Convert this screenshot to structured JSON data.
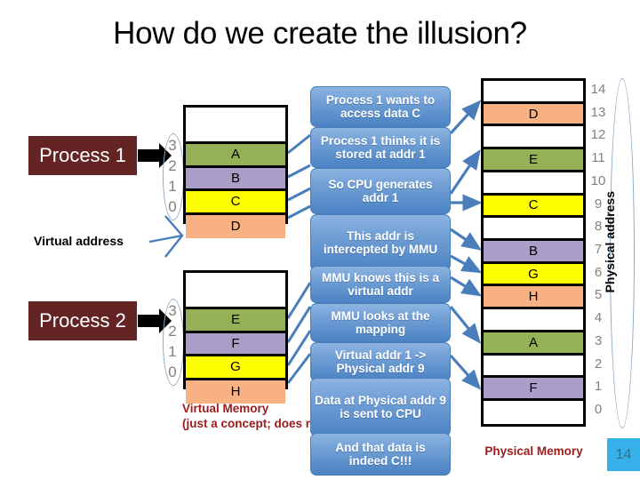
{
  "slide": {
    "title": "How do we create the illusion?",
    "page_number": "14"
  },
  "processes": [
    {
      "name": "process-1",
      "label": "Process 1"
    },
    {
      "name": "process-2",
      "label": "Process 2"
    }
  ],
  "labels": {
    "virtual_address": "Virtual address",
    "physical_address": "Physical address",
    "virtual_memory_line1": "Virtual Memory",
    "virtual_memory_line2": "(just a concept; does not exist physically)",
    "physical_memory": "Physical Memory"
  },
  "virtual_tables": [
    {
      "owner": "Process 1",
      "addresses": [
        "3",
        "2",
        "1",
        "0"
      ],
      "rows": [
        {
          "label": "",
          "color": "#ffffff"
        },
        {
          "label": "A",
          "color": "#94b155"
        },
        {
          "label": "B",
          "color": "#aa9dc8"
        },
        {
          "label": "C",
          "color": "#ffff00"
        },
        {
          "label": "D",
          "color": "#f8b183"
        }
      ]
    },
    {
      "owner": "Process 2",
      "addresses": [
        "3",
        "2",
        "1",
        "0"
      ],
      "rows": [
        {
          "label": "",
          "color": "#ffffff"
        },
        {
          "label": "E",
          "color": "#94b155"
        },
        {
          "label": "F",
          "color": "#aa9dc8"
        },
        {
          "label": "G",
          "color": "#ffff00"
        },
        {
          "label": "H",
          "color": "#f8b183"
        }
      ]
    }
  ],
  "physical_table": {
    "addresses": [
      "14",
      "13",
      "12",
      "11",
      "10",
      "9",
      "8",
      "7",
      "6",
      "5",
      "4",
      "3",
      "2",
      "1",
      "0"
    ],
    "rows": [
      {
        "addr": "14",
        "label": "",
        "color": "#ffffff"
      },
      {
        "addr": "13",
        "label": "D",
        "color": "#f8b183"
      },
      {
        "addr": "12",
        "label": "",
        "color": "#ffffff"
      },
      {
        "addr": "11",
        "label": "E",
        "color": "#94b155"
      },
      {
        "addr": "10",
        "label": "",
        "color": "#ffffff"
      },
      {
        "addr": "9",
        "label": "C",
        "color": "#ffff00"
      },
      {
        "addr": "8",
        "label": "",
        "color": "#ffffff"
      },
      {
        "addr": "7",
        "label": "B",
        "color": "#aa9dc8"
      },
      {
        "addr": "6",
        "label": "G",
        "color": "#ffff00"
      },
      {
        "addr": "5",
        "label": "H",
        "color": "#f8b183"
      },
      {
        "addr": "4",
        "label": "",
        "color": "#ffffff"
      },
      {
        "addr": "3",
        "label": "A",
        "color": "#94b155"
      },
      {
        "addr": "2",
        "label": "",
        "color": "#ffffff"
      },
      {
        "addr": "1",
        "label": "F",
        "color": "#aa9dc8"
      },
      {
        "addr": "0",
        "label": "",
        "color": "#ffffff"
      }
    ]
  },
  "callouts": [
    {
      "id": "c1",
      "text": "Process 1 wants to access data C"
    },
    {
      "id": "c2",
      "text": "Process 1 thinks it is stored at addr 1"
    },
    {
      "id": "c3",
      "text": "So CPU generates addr 1"
    },
    {
      "id": "c4",
      "text": "This addr is intercepted by MMU"
    },
    {
      "id": "c5",
      "text": "MMU knows this is a virtual addr"
    },
    {
      "id": "c6",
      "text": "MMU looks at the mapping"
    },
    {
      "id": "c7",
      "text": "Virtual addr 1 -> Physical addr 9"
    },
    {
      "id": "c8",
      "text": "Data at Physical addr 9 is sent to CPU"
    },
    {
      "id": "c9",
      "text": "And that data is indeed C!!!"
    }
  ],
  "colors": {
    "process_box": "#632423",
    "callout": "#6f9ed4",
    "red_label": "#9c1b1b",
    "page_badge": "#35b0e8",
    "connector": "#4a7ebb"
  }
}
